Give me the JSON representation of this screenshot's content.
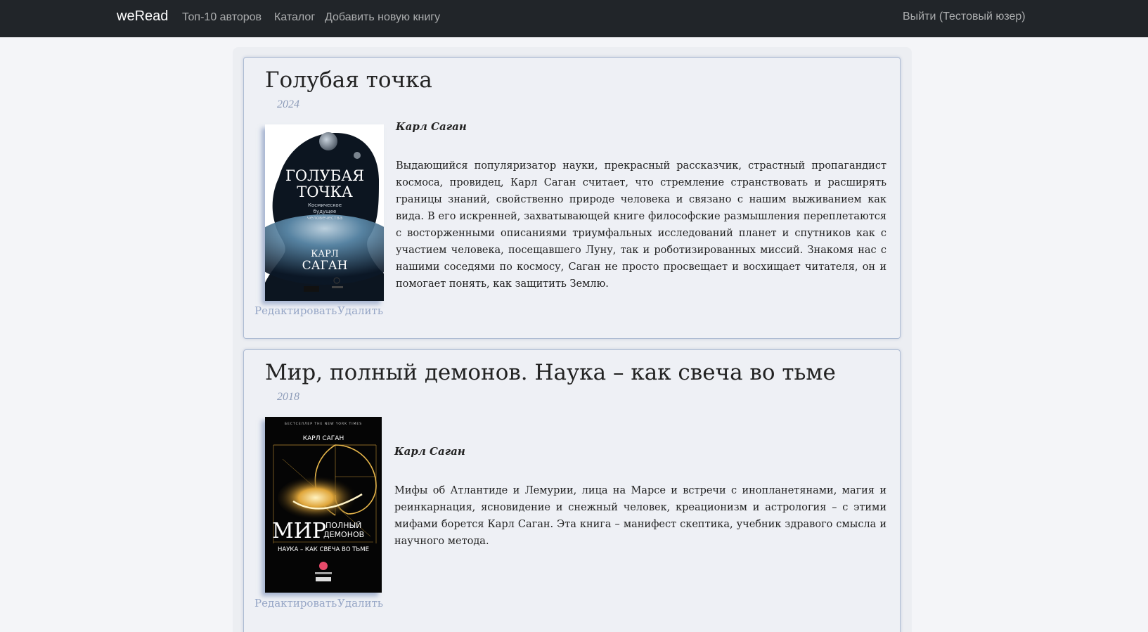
{
  "navbar": {
    "brand": "weRead",
    "links": [
      "Топ-10 авторов",
      "Каталог",
      "Добавить новую книгу"
    ],
    "logout": "Выйти (Тестовый юзер)"
  },
  "books": [
    {
      "title": "Голубая точка",
      "year": "2024",
      "author": "Карл Саган",
      "description": "Выдающийся популяризатор науки, прекрасный рассказчик, страстный пропагандист космоса, провидец, Карл Саган считает, что стремление странствовать и расширять границы знаний, свойственно природе человека и связано с нашим выживанием как вида. В его искренней, захватывающей книге философские размышления переплетаются с восторженными описаниями триумфальных исследований планет и спутников как с участием человека, посещавшего Луну, так и роботизированных миссий. Знакомя нас с нашими соседями по космосу, Саган не просто просвещает и восхищает читателя, он и помогает понять, как защитить Землю.",
      "edit_label": "Редактировать",
      "delete_label": "Удалить",
      "cover": {
        "title_line1": "ГОЛУБАЯ",
        "title_line2": "ТОЧКА",
        "subtitle1": "Космическое",
        "subtitle2": "будущее",
        "subtitle3": "человечества",
        "author_line1": "КАРЛ",
        "author_line2": "САГАН"
      }
    },
    {
      "title": "Мир, полный демонов. Наука – как свеча во тьме",
      "year": "2018",
      "author": "Карл Саган",
      "description": "Мифы об Атлантиде и Лемурии, лица на Марсе и встречи с инопланетянами, магия и реинкарнация, ясновидение и снежный человек, креационизм и астрология – с этими мифами борется Карл Саган. Эта книга – манифест скептика, учебник здравого смысла и научного метода.",
      "edit_label": "Редактировать",
      "delete_label": "Удалить",
      "cover": {
        "top_line": "БЕСТСЕЛЛЕР THE NEW YORK TIMES",
        "author": "КАРЛ САГАН",
        "title_big": "МИР",
        "title_small1": "ПОЛНЫЙ",
        "title_small2": "ДЕМОНОВ",
        "subtitle": "НАУКА – КАК СВЕЧА ВО ТЬМЕ"
      }
    }
  ]
}
